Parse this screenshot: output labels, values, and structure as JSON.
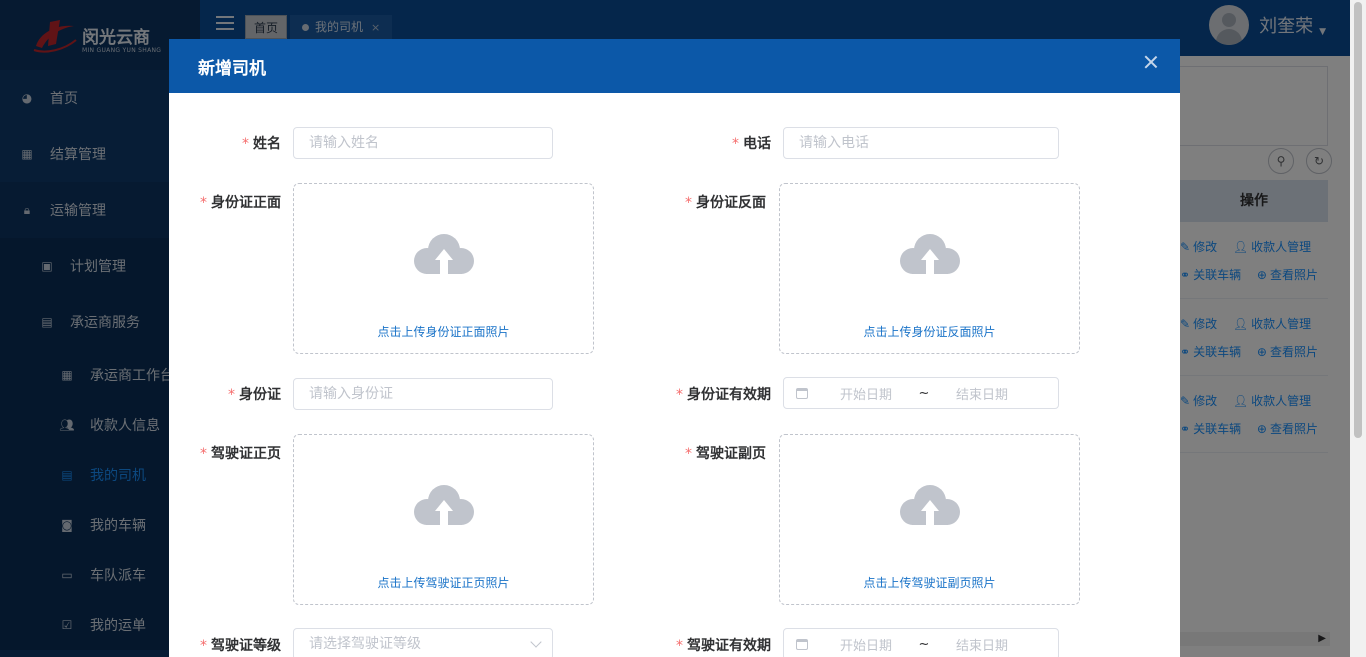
{
  "sidebar": {
    "logo_text": "闵光云商",
    "logo_sub": "MIN GUANG YUN SHANG",
    "items": [
      {
        "label": "首页"
      },
      {
        "label": "结算管理"
      },
      {
        "label": "运输管理"
      },
      {
        "label": "计划管理"
      },
      {
        "label": "承运商服务"
      },
      {
        "label": "承运商工作台"
      },
      {
        "label": "收款人信息"
      },
      {
        "label": "我的司机"
      },
      {
        "label": "我的车辆"
      },
      {
        "label": "车队派车"
      },
      {
        "label": "我的运单"
      }
    ]
  },
  "header": {
    "tabs": [
      {
        "label": "首页"
      },
      {
        "label": "我的司机",
        "close": "×"
      }
    ],
    "user_name": "刘奎荣"
  },
  "background": {
    "ops_header": "操作",
    "rows": [
      {
        "edit": "修改",
        "payee": "收款人管理",
        "link_vehicle": "关联车辆",
        "view_photo": "查看照片"
      },
      {
        "edit": "修改",
        "payee": "收款人管理",
        "link_vehicle": "关联车辆",
        "view_photo": "查看照片"
      },
      {
        "edit": "修改",
        "payee": "收款人管理",
        "link_vehicle": "关联车辆",
        "view_photo": "查看照片"
      }
    ]
  },
  "dialog": {
    "title": "新增司机",
    "required_mark": "*",
    "fields": {
      "name": {
        "label": "姓名",
        "placeholder": "请输入姓名",
        "value": ""
      },
      "phone": {
        "label": "电话",
        "placeholder": "请输入电话",
        "value": ""
      },
      "id_front": {
        "label": "身份证正面",
        "upload_text": "点击上传身份证正面照片"
      },
      "id_back": {
        "label": "身份证反面",
        "upload_text": "点击上传身份证反面照片"
      },
      "id_number": {
        "label": "身份证",
        "placeholder": "请输入身份证",
        "value": ""
      },
      "id_validity": {
        "label": "身份证有效期",
        "start_placeholder": "开始日期",
        "separator": "~",
        "end_placeholder": "结束日期"
      },
      "license_front": {
        "label": "驾驶证正页",
        "upload_text": "点击上传驾驶证正页照片"
      },
      "license_sub": {
        "label": "驾驶证副页",
        "upload_text": "点击上传驾驶证副页照片"
      },
      "license_class": {
        "label": "驾驶证等级",
        "placeholder": "请选择驾驶证等级"
      },
      "license_validity": {
        "label": "驾驶证有效期",
        "start_placeholder": "开始日期",
        "separator": "~",
        "end_placeholder": "结束日期"
      }
    }
  },
  "colors": {
    "sidebar_bg": "#0e3b6c",
    "header_bg": "#0a4d97",
    "dialog_header_bg": "#0c58a8",
    "accent": "#1890ff",
    "required": "#f56c6c"
  }
}
